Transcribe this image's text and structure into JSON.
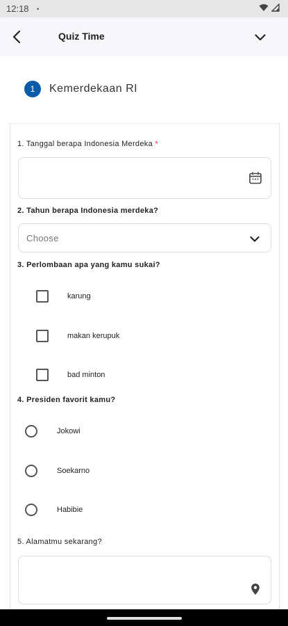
{
  "status_bar": {
    "time": "12:18",
    "indicator": "•"
  },
  "app_bar": {
    "title": "Quiz Time"
  },
  "step": {
    "number": "1",
    "title": "Kemerdekaan RI"
  },
  "questions": {
    "q1": {
      "label": "1. Tanggal berapa Indonesia Merdeka ",
      "required_mark": "*",
      "value": ""
    },
    "q2": {
      "label": "2. Tahun berapa Indonesia merdeka?",
      "selected": "Choose"
    },
    "q3": {
      "label": "3. Perlombaan apa yang kamu sukai?",
      "options": [
        "karung",
        "makan kerupuk",
        "bad minton"
      ],
      "checked": [
        false,
        false,
        false
      ]
    },
    "q4": {
      "label": "4. Presiden favorit kamu?",
      "options": [
        "Jokowi",
        "Soekarno",
        "Habibie"
      ],
      "selected": null
    },
    "q5": {
      "label": "5. Alamatmu sekarang?",
      "value": ""
    }
  },
  "icons": {
    "back": "arrow-back-icon",
    "collapse": "chevron-down-icon",
    "calendar": "calendar-icon",
    "dropdown": "chevron-down-icon",
    "location": "location-pin-icon"
  },
  "colors": {
    "accent": "#0b5ca8",
    "required": "#e53935",
    "app_bar_bg": "#f7f7fb",
    "status_bar_bg": "#e6e6e6"
  }
}
